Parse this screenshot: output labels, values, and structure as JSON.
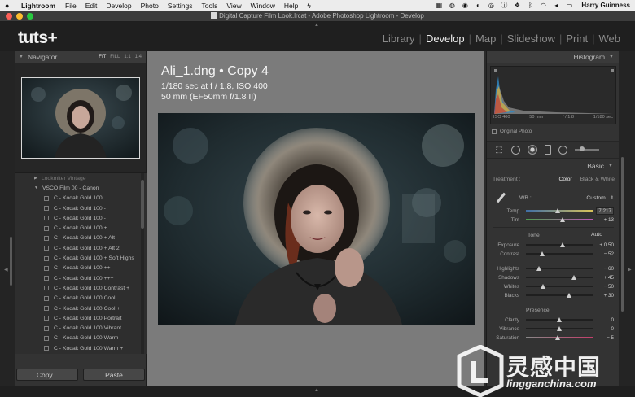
{
  "menubar": {
    "app_name": "Lightroom",
    "items": [
      "File",
      "Edit",
      "Develop",
      "Photo",
      "Settings",
      "Tools",
      "View",
      "Window",
      "Help"
    ],
    "user": "Harry Guinness"
  },
  "window": {
    "title": "Digital Capture Film Look.lrcat - Adobe Photoshop Lightroom - Develop"
  },
  "identity_plate": {
    "logo": "tuts+"
  },
  "modules": {
    "library": "Library",
    "develop": "Develop",
    "map": "Map",
    "slideshow": "Slideshow",
    "print": "Print",
    "web": "Web"
  },
  "navigator": {
    "title": "Navigator",
    "zoom_fit": "FIT",
    "zoom_fill": "FILL",
    "zoom_1": "1:1",
    "zoom_custom": "1:4"
  },
  "presets": {
    "clipped_item": "Lookmiter Vintage",
    "folder": "VSCO Film 00 - Canon",
    "items": [
      "C - Kodak Gold 100",
      "C - Kodak Gold 100 -",
      "C - Kodak Gold 100 -",
      "C - Kodak Gold 100 +",
      "C - Kodak Gold 100 + Alt",
      "C - Kodak Gold 100 + Alt 2",
      "C - Kodak Gold 100 + Soft Highs",
      "C - Kodak Gold 100 ++",
      "C - Kodak Gold 100 +++",
      "C - Kodak Gold 100 Contrast +",
      "C - Kodak Gold 100 Cool",
      "C - Kodak Gold 100 Cool +",
      "C - Kodak Gold 100 Portrait",
      "C - Kodak Gold 100 Vibrant",
      "C - Kodak Gold 100 Warm",
      "C - Kodak Gold 100 Warm +"
    ]
  },
  "left_buttons": {
    "copy": "Copy...",
    "paste": "Paste"
  },
  "photo_info": {
    "filename": "Ali_1.dng  •  Copy 4",
    "exposure": "1/180 sec at f / 1.8, ISO 400",
    "lens": "50 mm (EF50mm f/1.8 II)"
  },
  "histogram": {
    "title": "Histogram",
    "iso": "ISO 400",
    "focal": "50 mm",
    "aperture": "f / 1.8",
    "shutter": "1/180 sec",
    "original_photo": "Original Photo"
  },
  "basic": {
    "title": "Basic",
    "treatment_label": "Treatment :",
    "treatment_color": "Color",
    "treatment_bw": "Black & White",
    "wb_label": "WB :",
    "wb_value": "Custom",
    "tone_label": "Tone",
    "auto_label": "Auto",
    "presence_label": "Presence",
    "sliders": {
      "temp": {
        "label": "Temp",
        "value": "7,217",
        "position": 0.47
      },
      "tint": {
        "label": "Tint",
        "value": "+ 13",
        "position": 0.55
      },
      "exposure": {
        "label": "Exposure",
        "value": "+ 0.50",
        "position": 0.55
      },
      "contrast": {
        "label": "Contrast",
        "value": "− 52",
        "position": 0.24
      },
      "highlights": {
        "label": "Highlights",
        "value": "− 60",
        "position": 0.2
      },
      "shadows": {
        "label": "Shadows",
        "value": "+ 45",
        "position": 0.72
      },
      "whites": {
        "label": "Whites",
        "value": "− 50",
        "position": 0.25
      },
      "blacks": {
        "label": "Blacks",
        "value": "+ 30",
        "position": 0.65
      },
      "clarity": {
        "label": "Clarity",
        "value": "0",
        "position": 0.5
      },
      "vibrance": {
        "label": "Vibrance",
        "value": "0",
        "position": 0.5
      },
      "saturation": {
        "label": "Saturation",
        "value": "− 5",
        "position": 0.47
      }
    }
  },
  "watermark": {
    "title": "灵感中国",
    "site": "lingganchina.com"
  },
  "colors": {
    "panel": "#333333",
    "canvas": "#7b7b7b",
    "accent_text": "#ececec"
  }
}
